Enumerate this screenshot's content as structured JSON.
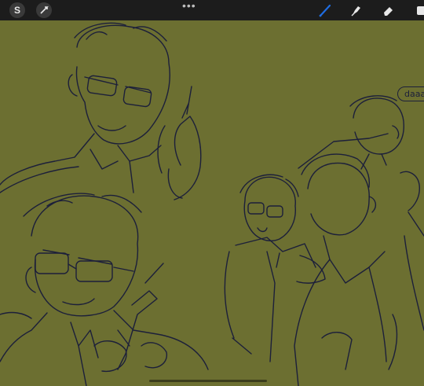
{
  "toolbar": {
    "left_tools": [
      "adjustments-icon",
      "selection-icon"
    ],
    "more_label": "•••",
    "right_tools": [
      "brush-icon",
      "smudge-icon",
      "eraser-icon",
      "layers-icon"
    ],
    "active_tool": "brush-icon",
    "colors": {
      "bar": "#1c1c1c",
      "active": "#1f6de2",
      "inactive": "#e8e8e8"
    }
  },
  "canvas": {
    "background": "#6c6f31",
    "line_color": "#1c1f3a",
    "speech_bubble_text": "daaa"
  }
}
